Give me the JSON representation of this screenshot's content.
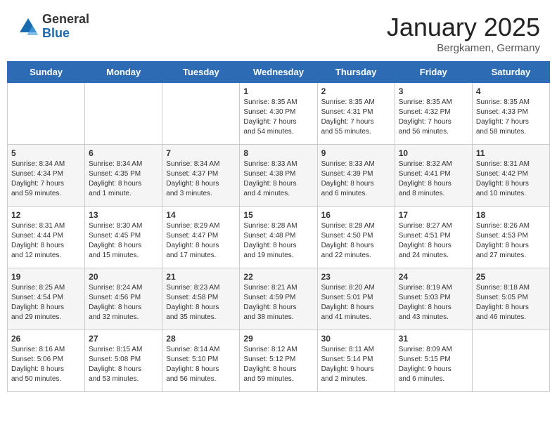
{
  "header": {
    "logo_general": "General",
    "logo_blue": "Blue",
    "month": "January 2025",
    "location": "Bergkamen, Germany"
  },
  "weekdays": [
    "Sunday",
    "Monday",
    "Tuesday",
    "Wednesday",
    "Thursday",
    "Friday",
    "Saturday"
  ],
  "weeks": [
    [
      {
        "day": "",
        "info": ""
      },
      {
        "day": "",
        "info": ""
      },
      {
        "day": "",
        "info": ""
      },
      {
        "day": "1",
        "info": "Sunrise: 8:35 AM\nSunset: 4:30 PM\nDaylight: 7 hours\nand 54 minutes."
      },
      {
        "day": "2",
        "info": "Sunrise: 8:35 AM\nSunset: 4:31 PM\nDaylight: 7 hours\nand 55 minutes."
      },
      {
        "day": "3",
        "info": "Sunrise: 8:35 AM\nSunset: 4:32 PM\nDaylight: 7 hours\nand 56 minutes."
      },
      {
        "day": "4",
        "info": "Sunrise: 8:35 AM\nSunset: 4:33 PM\nDaylight: 7 hours\nand 58 minutes."
      }
    ],
    [
      {
        "day": "5",
        "info": "Sunrise: 8:34 AM\nSunset: 4:34 PM\nDaylight: 7 hours\nand 59 minutes."
      },
      {
        "day": "6",
        "info": "Sunrise: 8:34 AM\nSunset: 4:35 PM\nDaylight: 8 hours\nand 1 minute."
      },
      {
        "day": "7",
        "info": "Sunrise: 8:34 AM\nSunset: 4:37 PM\nDaylight: 8 hours\nand 3 minutes."
      },
      {
        "day": "8",
        "info": "Sunrise: 8:33 AM\nSunset: 4:38 PM\nDaylight: 8 hours\nand 4 minutes."
      },
      {
        "day": "9",
        "info": "Sunrise: 8:33 AM\nSunset: 4:39 PM\nDaylight: 8 hours\nand 6 minutes."
      },
      {
        "day": "10",
        "info": "Sunrise: 8:32 AM\nSunset: 4:41 PM\nDaylight: 8 hours\nand 8 minutes."
      },
      {
        "day": "11",
        "info": "Sunrise: 8:31 AM\nSunset: 4:42 PM\nDaylight: 8 hours\nand 10 minutes."
      }
    ],
    [
      {
        "day": "12",
        "info": "Sunrise: 8:31 AM\nSunset: 4:44 PM\nDaylight: 8 hours\nand 12 minutes."
      },
      {
        "day": "13",
        "info": "Sunrise: 8:30 AM\nSunset: 4:45 PM\nDaylight: 8 hours\nand 15 minutes."
      },
      {
        "day": "14",
        "info": "Sunrise: 8:29 AM\nSunset: 4:47 PM\nDaylight: 8 hours\nand 17 minutes."
      },
      {
        "day": "15",
        "info": "Sunrise: 8:28 AM\nSunset: 4:48 PM\nDaylight: 8 hours\nand 19 minutes."
      },
      {
        "day": "16",
        "info": "Sunrise: 8:28 AM\nSunset: 4:50 PM\nDaylight: 8 hours\nand 22 minutes."
      },
      {
        "day": "17",
        "info": "Sunrise: 8:27 AM\nSunset: 4:51 PM\nDaylight: 8 hours\nand 24 minutes."
      },
      {
        "day": "18",
        "info": "Sunrise: 8:26 AM\nSunset: 4:53 PM\nDaylight: 8 hours\nand 27 minutes."
      }
    ],
    [
      {
        "day": "19",
        "info": "Sunrise: 8:25 AM\nSunset: 4:54 PM\nDaylight: 8 hours\nand 29 minutes."
      },
      {
        "day": "20",
        "info": "Sunrise: 8:24 AM\nSunset: 4:56 PM\nDaylight: 8 hours\nand 32 minutes."
      },
      {
        "day": "21",
        "info": "Sunrise: 8:23 AM\nSunset: 4:58 PM\nDaylight: 8 hours\nand 35 minutes."
      },
      {
        "day": "22",
        "info": "Sunrise: 8:21 AM\nSunset: 4:59 PM\nDaylight: 8 hours\nand 38 minutes."
      },
      {
        "day": "23",
        "info": "Sunrise: 8:20 AM\nSunset: 5:01 PM\nDaylight: 8 hours\nand 41 minutes."
      },
      {
        "day": "24",
        "info": "Sunrise: 8:19 AM\nSunset: 5:03 PM\nDaylight: 8 hours\nand 43 minutes."
      },
      {
        "day": "25",
        "info": "Sunrise: 8:18 AM\nSunset: 5:05 PM\nDaylight: 8 hours\nand 46 minutes."
      }
    ],
    [
      {
        "day": "26",
        "info": "Sunrise: 8:16 AM\nSunset: 5:06 PM\nDaylight: 8 hours\nand 50 minutes."
      },
      {
        "day": "27",
        "info": "Sunrise: 8:15 AM\nSunset: 5:08 PM\nDaylight: 8 hours\nand 53 minutes."
      },
      {
        "day": "28",
        "info": "Sunrise: 8:14 AM\nSunset: 5:10 PM\nDaylight: 8 hours\nand 56 minutes."
      },
      {
        "day": "29",
        "info": "Sunrise: 8:12 AM\nSunset: 5:12 PM\nDaylight: 8 hours\nand 59 minutes."
      },
      {
        "day": "30",
        "info": "Sunrise: 8:11 AM\nSunset: 5:14 PM\nDaylight: 9 hours\nand 2 minutes."
      },
      {
        "day": "31",
        "info": "Sunrise: 8:09 AM\nSunset: 5:15 PM\nDaylight: 9 hours\nand 6 minutes."
      },
      {
        "day": "",
        "info": ""
      }
    ]
  ]
}
